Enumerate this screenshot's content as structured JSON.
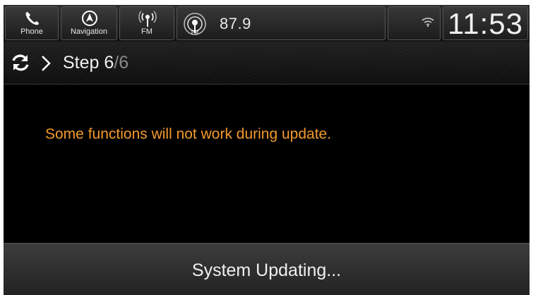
{
  "status_bar": {
    "phone": {
      "label": "Phone",
      "icon": "phone-icon"
    },
    "navigation": {
      "label": "Navigation",
      "icon": "navigation-icon"
    },
    "radio": {
      "label": "FM",
      "icon": "radio-antenna-icon"
    },
    "audio_source": {
      "band_label": "FM",
      "frequency": "87.9",
      "icon": "fm-radio-icon"
    },
    "wifi": {
      "icon": "wifi-icon"
    },
    "clock": "11:53"
  },
  "step_header": {
    "refresh_icon": "refresh-icon",
    "chevron_icon": "chevron-right-icon",
    "label": "Step",
    "current": "6",
    "total": "/6"
  },
  "content": {
    "warning": "Some functions will not work during update."
  },
  "bottom_bar": {
    "status": "System Updating..."
  },
  "colors": {
    "warning_text": "#f29a2e",
    "background": "#000000",
    "text": "#f0f0f0"
  }
}
